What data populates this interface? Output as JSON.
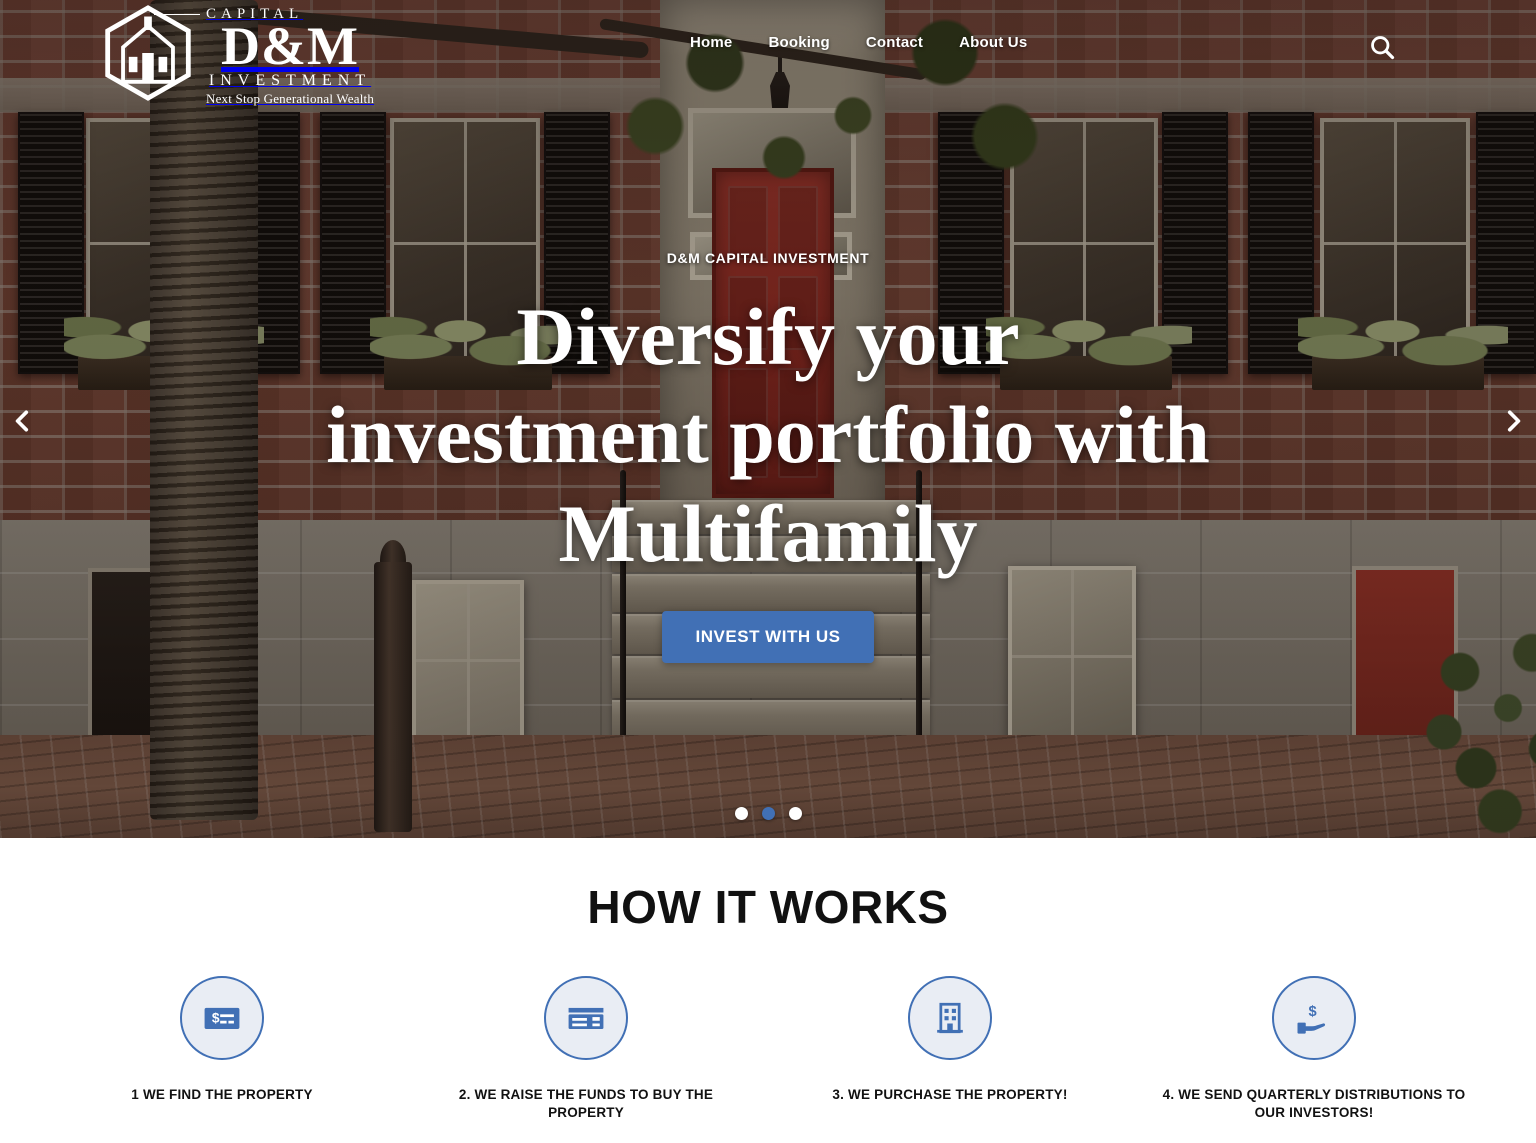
{
  "brand": {
    "capital": "CAPITAL",
    "name": "D&M",
    "investment": "INVESTMENT",
    "tagline": "Next Stop Generational Wealth",
    "logo_icon": "house-hexagon-logo"
  },
  "nav": {
    "items": [
      {
        "label": "Home"
      },
      {
        "label": "Booking"
      },
      {
        "label": "Contact"
      },
      {
        "label": "About Us"
      }
    ],
    "search_icon": "search-icon"
  },
  "hero": {
    "eyebrow": "D&M CAPITAL INVESTMENT",
    "headline": "Diversify your investment portfolio with Multifamily",
    "cta_label": "INVEST WITH US",
    "prev_icon": "chevron-left-icon",
    "next_icon": "chevron-right-icon",
    "slides": 3,
    "active_slide": 2,
    "accent_color": "#4170b5"
  },
  "works": {
    "title": "HOW IT WORKS",
    "steps": [
      {
        "label": "1 WE FIND THE PROPERTY",
        "icon": "money-check-icon"
      },
      {
        "label": "2. WE RAISE THE FUNDS TO BUY THE PROPERTY",
        "icon": "credit-card-icon"
      },
      {
        "label": "3. WE PURCHASE THE PROPERTY!",
        "icon": "building-icon"
      },
      {
        "label": "4. WE SEND QUARTERLY DISTRIBUTIONS TO OUR INVESTORS!",
        "icon": "hand-holding-dollar-icon"
      }
    ]
  }
}
